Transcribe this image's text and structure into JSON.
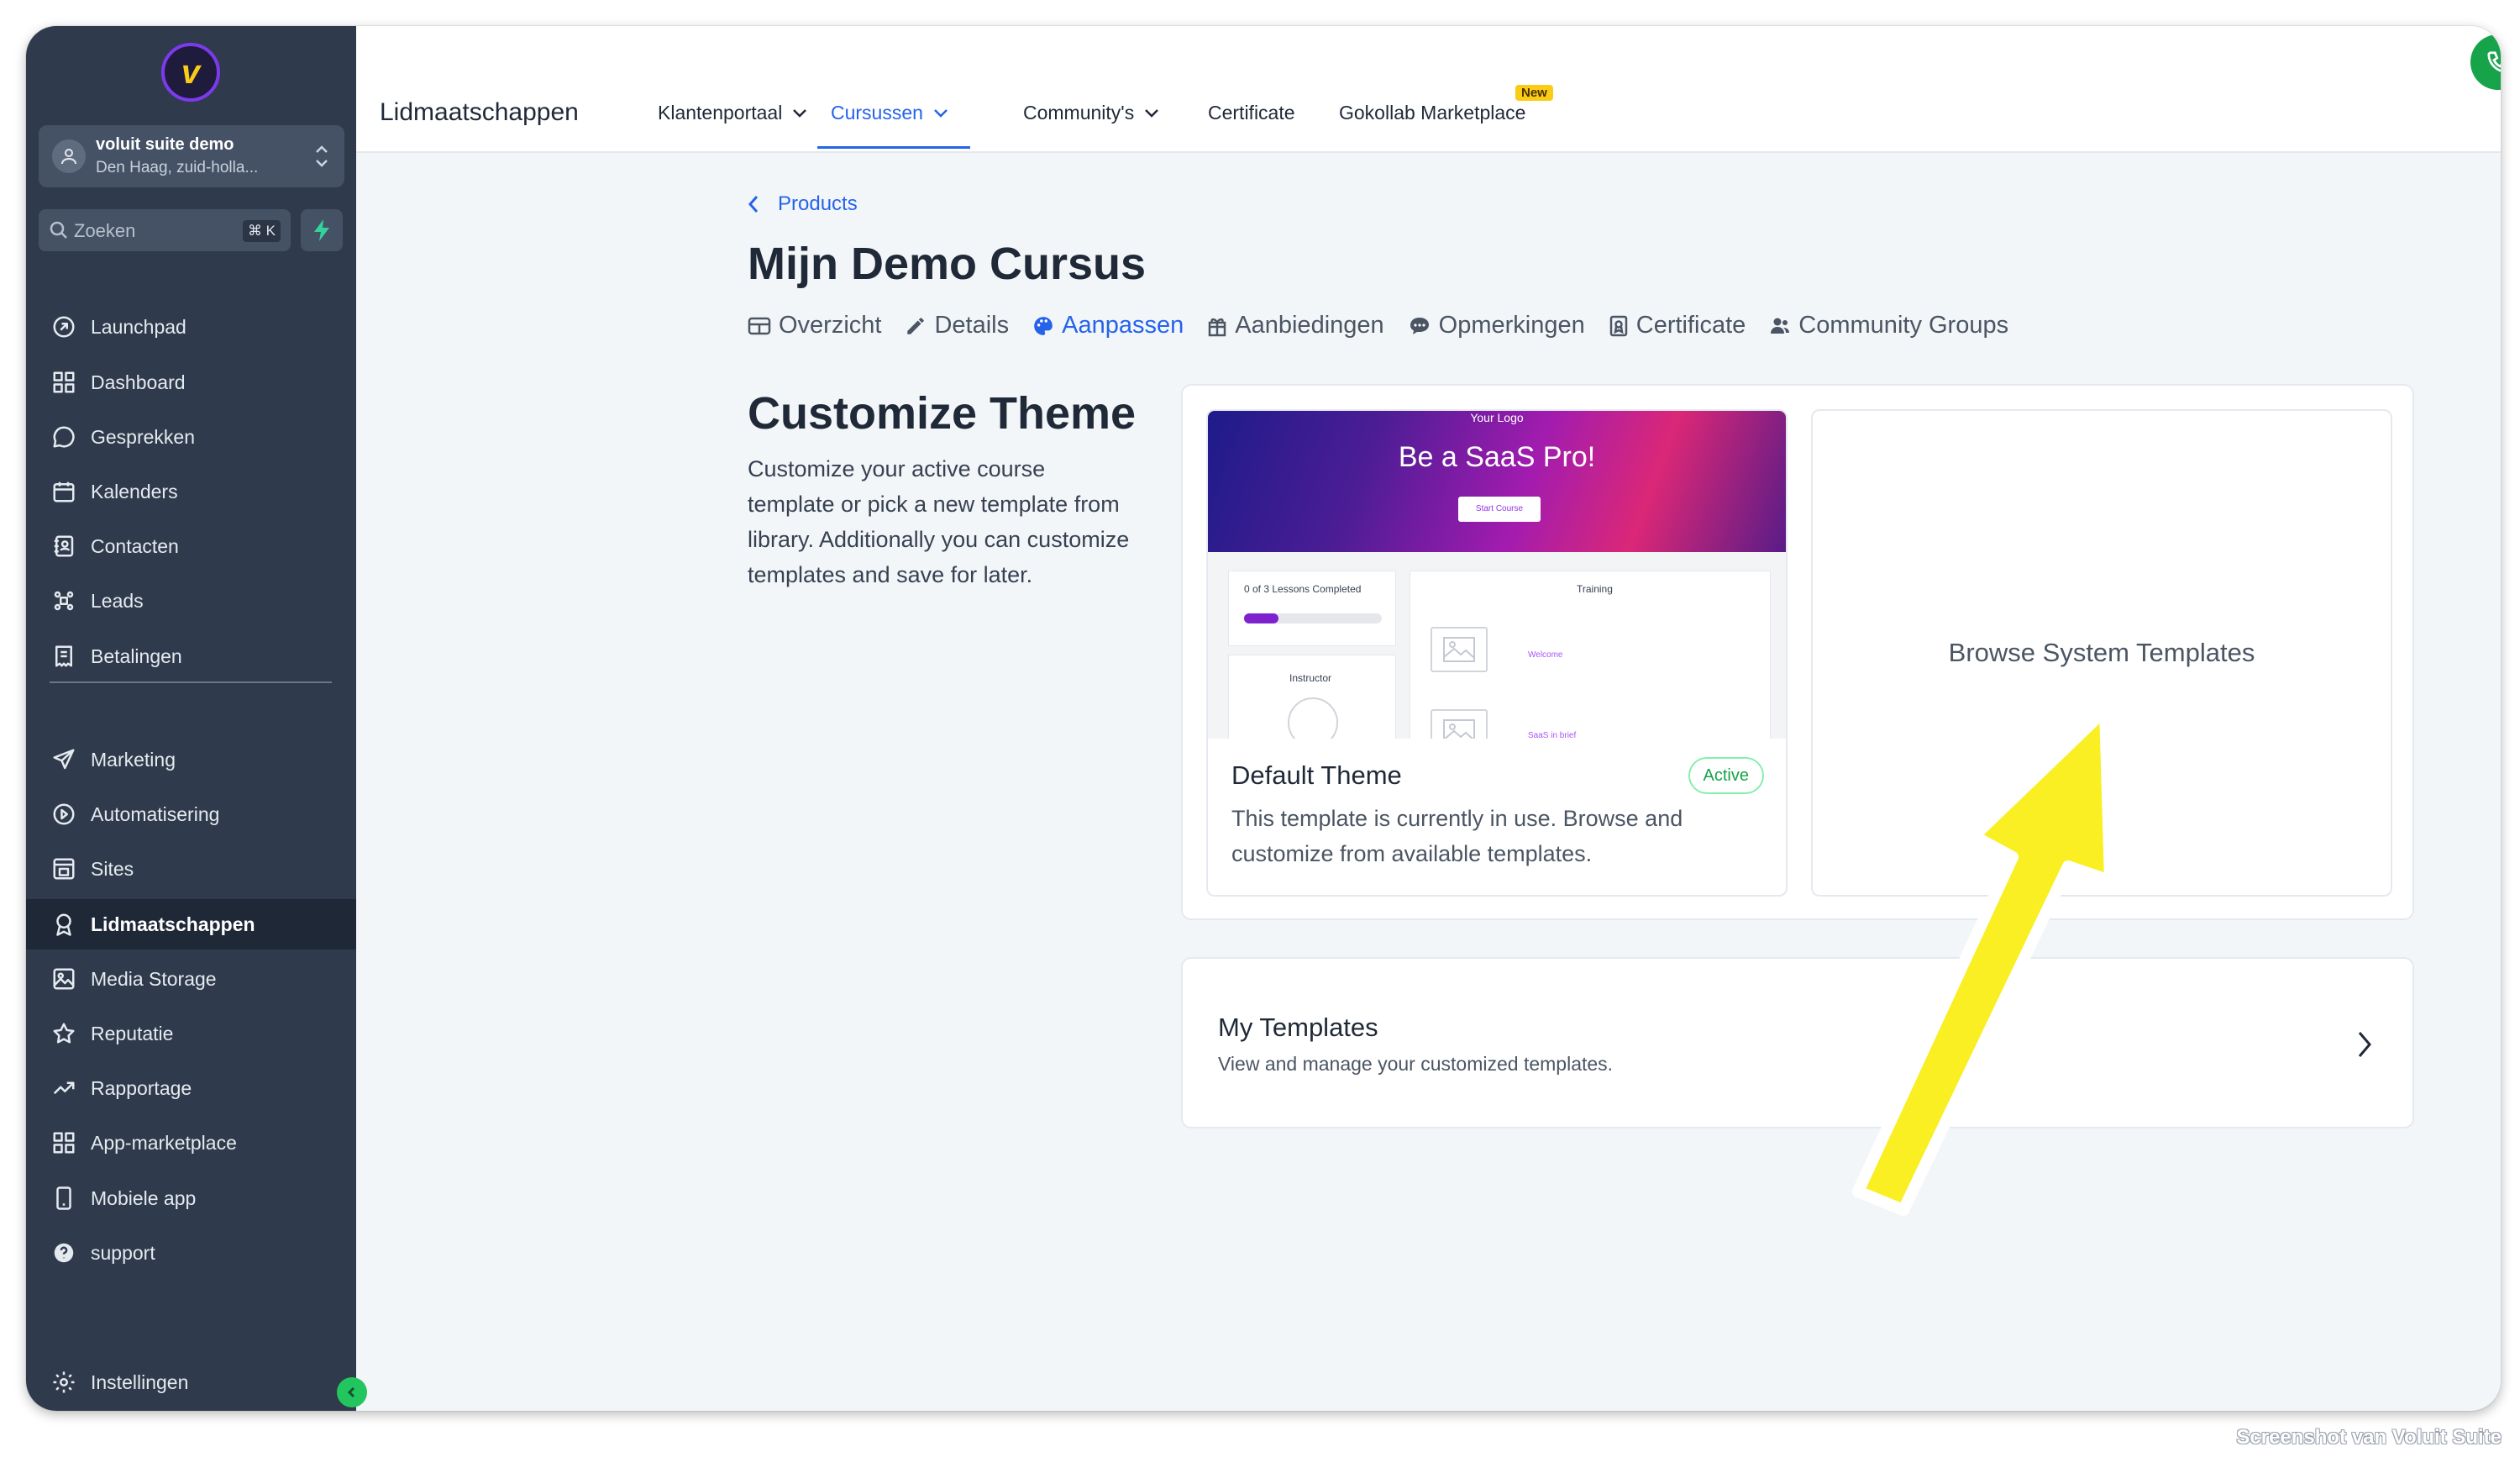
{
  "sidebar": {
    "account": {
      "name": "voluit suite demo",
      "location": "Den Haag, zuid-holla..."
    },
    "search": {
      "placeholder": "Zoeken",
      "shortcut": "⌘ K"
    },
    "items": [
      {
        "label": "Launchpad",
        "icon": "launchpad-icon"
      },
      {
        "label": "Dashboard",
        "icon": "dashboard-icon"
      },
      {
        "label": "Gesprekken",
        "icon": "chat-icon"
      },
      {
        "label": "Kalenders",
        "icon": "calendar-icon"
      },
      {
        "label": "Contacten",
        "icon": "contacts-icon"
      },
      {
        "label": "Leads",
        "icon": "leads-icon"
      },
      {
        "label": "Betalingen",
        "icon": "payments-icon"
      },
      {
        "label": "Marketing",
        "icon": "send-icon"
      },
      {
        "label": "Automatisering",
        "icon": "automation-icon"
      },
      {
        "label": "Sites",
        "icon": "sites-icon"
      },
      {
        "label": "Lidmaatschappen",
        "icon": "award-icon"
      },
      {
        "label": "Media Storage",
        "icon": "image-icon"
      },
      {
        "label": "Reputatie",
        "icon": "star-icon"
      },
      {
        "label": "Rapportage",
        "icon": "trend-icon"
      },
      {
        "label": "App-marketplace",
        "icon": "grid-icon"
      },
      {
        "label": "Mobiele app",
        "icon": "mobile-icon"
      },
      {
        "label": "support",
        "icon": "help-icon"
      }
    ],
    "settings_label": "Instellingen"
  },
  "topnav": {
    "title": "Lidmaatschappen",
    "tabs": [
      {
        "label": "Klantenportaal"
      },
      {
        "label": "Cursussen"
      },
      {
        "label": "Community's"
      },
      {
        "label": "Certificate"
      },
      {
        "label": "Gokollab Marketplace"
      }
    ],
    "new_badge": "New"
  },
  "main": {
    "breadcrumb": "Products",
    "title": "Mijn Demo Cursus",
    "subtabs": [
      {
        "label": "Overzicht",
        "icon": "table-icon"
      },
      {
        "label": "Details",
        "icon": "pencil-icon"
      },
      {
        "label": "Aanpassen",
        "icon": "palette-icon"
      },
      {
        "label": "Aanbiedingen",
        "icon": "gift-icon"
      },
      {
        "label": "Opmerkingen",
        "icon": "comment-icon"
      },
      {
        "label": "Certificate",
        "icon": "certificate-icon"
      },
      {
        "label": "Community Groups",
        "icon": "users-icon"
      }
    ],
    "active_subtab": "Aanpassen"
  },
  "customize": {
    "title": "Customize Theme",
    "description": "Customize your active course template or pick a new template from library. Additionally you can customize templates and save for later.",
    "default_theme": {
      "name": "Default Theme",
      "badge": "Active",
      "description": "This template is currently in use. Browse and customize from available templates.",
      "preview": {
        "logo_text": "Your Logo",
        "hero_title": "Be a SaaS Pro!",
        "hero_button": "Start Course",
        "progress_text": "0 of 3 Lessons Completed",
        "progress": 0.25,
        "instructor": "Instructor",
        "training": "Training",
        "lesson_1": "Welcome",
        "lesson_2": "SaaS in brief"
      }
    },
    "browse_label": "Browse System Templates",
    "my_templates": {
      "title": "My Templates",
      "description": "View and manage your customized templates."
    }
  },
  "annotation": {
    "arrow_color": "#f9ef22"
  },
  "watermark": "Screenshot van Voluit Suite",
  "colors": {
    "sidebar": "#2f3b4c",
    "accent": "#2563eb",
    "active_badge": "#16a34a"
  }
}
